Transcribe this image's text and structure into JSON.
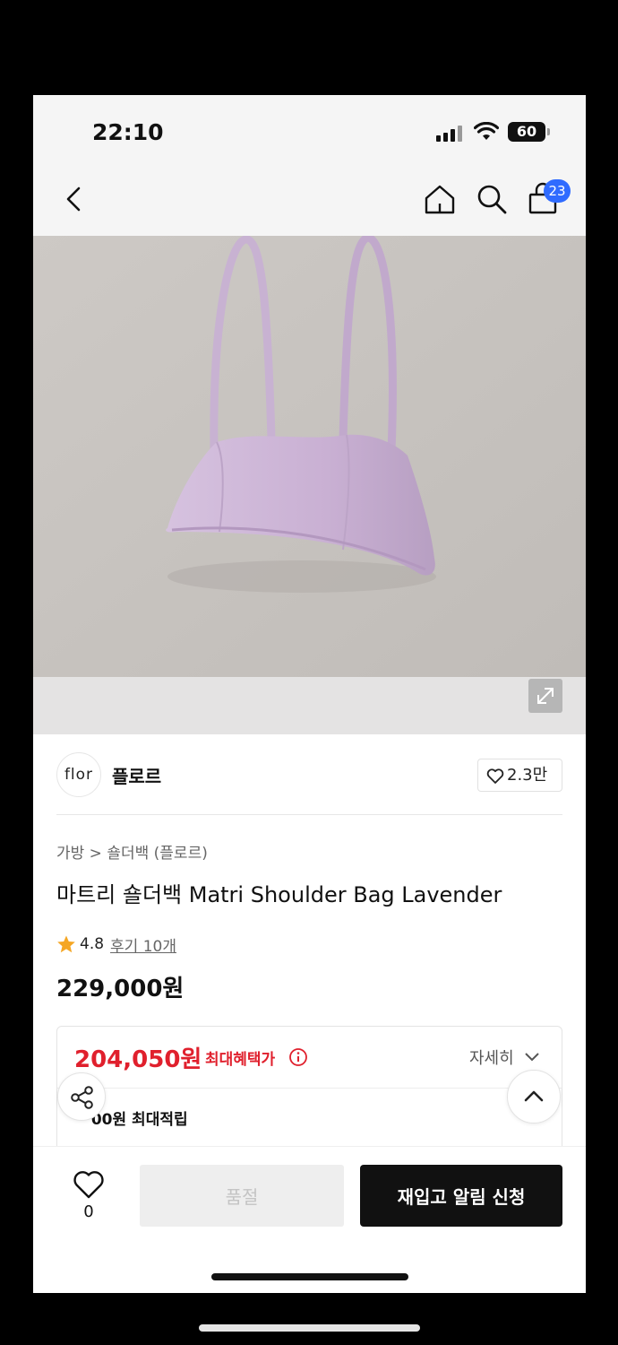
{
  "status_bar": {
    "time": "22:10",
    "battery": "60"
  },
  "nav": {
    "cart_count": "23"
  },
  "brand": {
    "logo_text": "flor",
    "name": "플로르",
    "likes": "2.3만"
  },
  "product": {
    "breadcrumb": "가방 > 숄더백 (플로르)",
    "title": "마트리 숄더백 Matri Shoulder Bag Lavender",
    "rating": "4.8",
    "reviews": "후기 10개",
    "price": "229,000원"
  },
  "benefit": {
    "price": "204,050원",
    "label": "최대혜택가",
    "detail_link": "자세히",
    "points": "  00원 최대적립"
  },
  "bottom_bar": {
    "wish_count": "0",
    "soldout_label": "품절",
    "restock_label": "재입고 알림 신청"
  },
  "colors": {
    "accent_red": "#e0202d",
    "badge_blue": "#2f6bff",
    "bag": "#cdb6d8",
    "backdrop": "#c7c3bf"
  }
}
